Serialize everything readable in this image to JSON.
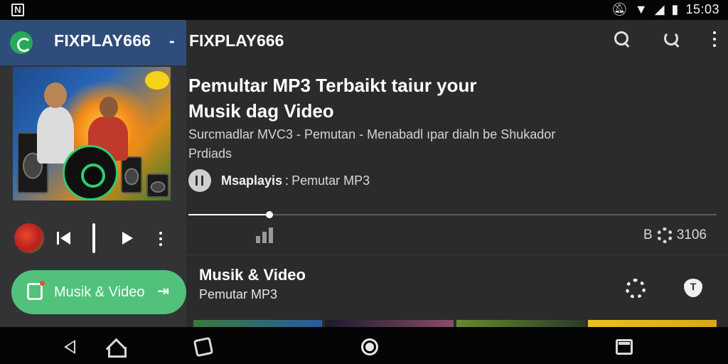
{
  "status_bar": {
    "app_badge": "N",
    "icons": [
      "notification-mute-icon",
      "wifi-icon",
      "signal-icon",
      "battery-icon"
    ],
    "time": "15:03"
  },
  "app_header": {
    "title": "FIXPLAY666",
    "dash": "-"
  },
  "now_playing": {
    "cover_icon": "album-art"
  },
  "mini_player": {
    "controls": [
      "previous-icon",
      "pause-icon",
      "play-icon",
      "more-icon"
    ]
  },
  "cta": {
    "label": "Musik & Video",
    "arrow": "⇥"
  },
  "toolbar": {
    "title": "FIXPLAY666",
    "icons": [
      "search-icon",
      "refresh-icon",
      "more-vert-icon"
    ]
  },
  "detail": {
    "headline_line1": "Pemultar MP3 Terbaikt taiur your",
    "headline_line2": "Musik dag Video",
    "sub_line1": "Surcmadlar MVC3 - Pemutan - Menabadl ıpar dialn be Shukador",
    "sub_line2": "Prdiads",
    "source_name": "Msaplayis",
    "source_sep": ":",
    "source_desc": "Pemutar MP3",
    "progress": 0.154,
    "stats_label_left": "B",
    "stats_label_right": "3106"
  },
  "card": {
    "title": "Musik & Video",
    "subtitle": "Pemutar MP3"
  },
  "colors": {
    "accent_green": "#52c17c",
    "header_blue": "#2f4d7a",
    "background": "#2b2b2d"
  }
}
